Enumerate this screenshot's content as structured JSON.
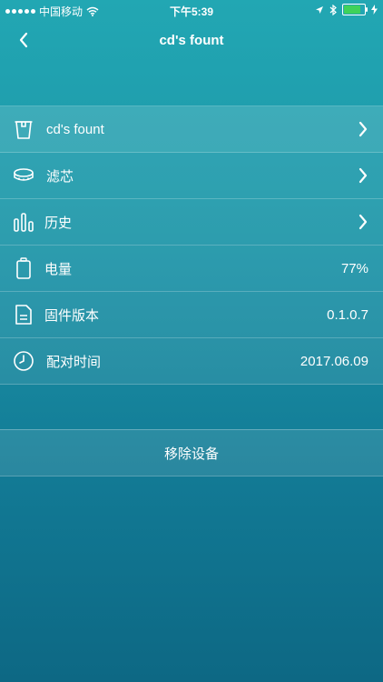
{
  "status_bar": {
    "carrier": "中国移动",
    "time": "下午5:39",
    "battery_color": "#3fd25a"
  },
  "nav": {
    "title": "cd's fount"
  },
  "rows": [
    {
      "label": "cd's fount",
      "icon": "cup-icon",
      "action": "chevron"
    },
    {
      "label": "滤芯",
      "icon": "filter-icon",
      "action": "chevron"
    },
    {
      "label": "历史",
      "icon": "bar-chart-icon",
      "action": "chevron"
    },
    {
      "label": "电量",
      "icon": "battery-icon",
      "value": "77%"
    },
    {
      "label": "固件版本",
      "icon": "document-icon",
      "value": "0.1.0.7"
    },
    {
      "label": "配对时间",
      "icon": "clock-icon",
      "value": "2017.06.09"
    }
  ],
  "remove_label": "移除设备"
}
